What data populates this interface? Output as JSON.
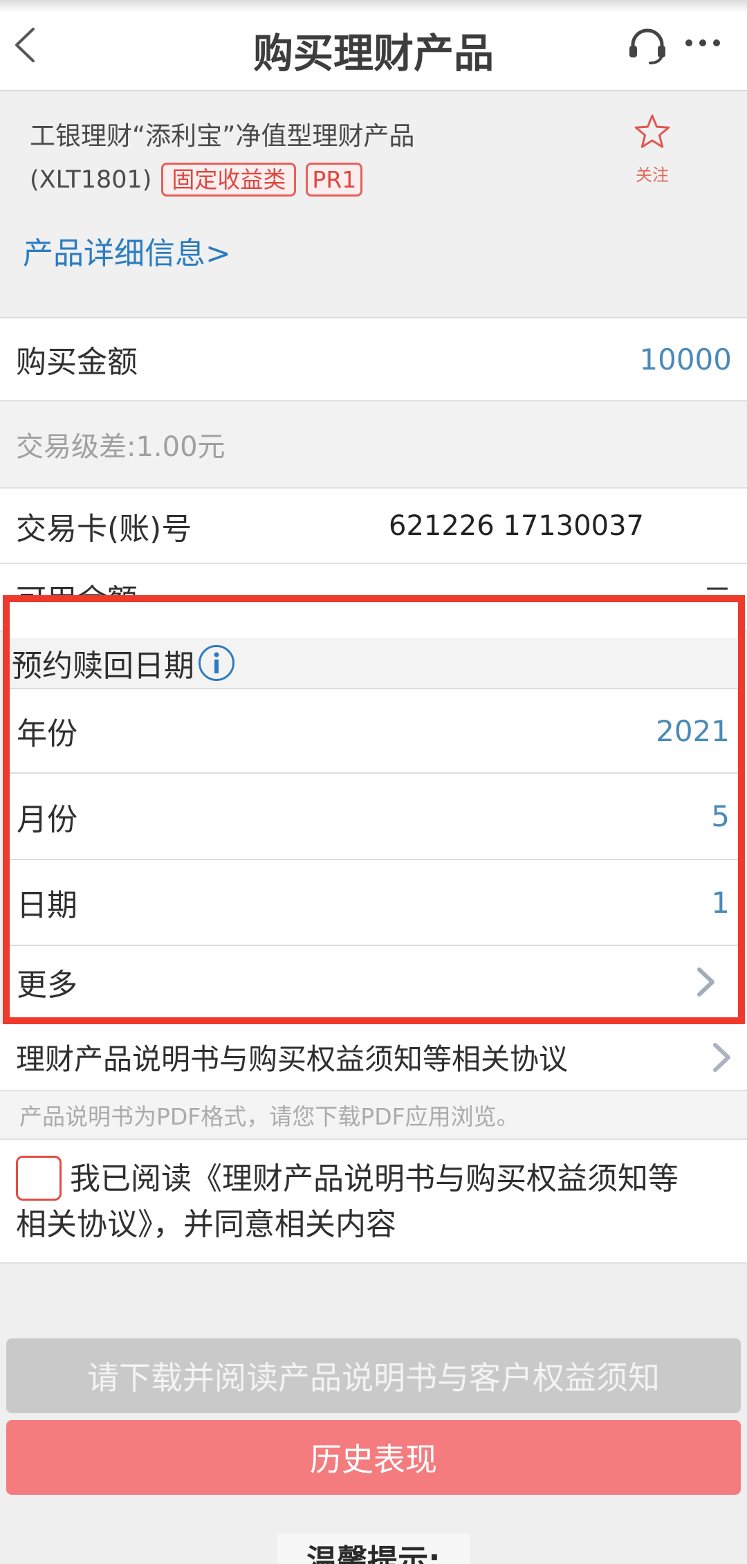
{
  "header": {
    "title": "购买理财产品",
    "back_icon": "chevron-left-icon",
    "service_icon": "headset-icon",
    "more_icon": "more-dots-icon"
  },
  "product": {
    "name": "工银理财“添利宝”净值型理财产品",
    "code": "(XLT1801)",
    "badges": [
      "固定收益类",
      "PR1"
    ],
    "follow_icon": "star-icon",
    "follow_label": "关注",
    "detail_link": "产品详细信息>"
  },
  "form": {
    "amount": {
      "label": "购买金额",
      "value": "10000"
    },
    "spread": "交易级差:1.00元",
    "card": {
      "label": "交易卡(账)号",
      "value": "621226 17130037"
    },
    "balance": {
      "label": "可用余额",
      "unit": "元"
    }
  },
  "redemption": {
    "title": "预约赎回日期",
    "info_icon": "info-icon",
    "rows": [
      {
        "label": "年份",
        "value": "2021"
      },
      {
        "label": "月份",
        "value": "5"
      },
      {
        "label": "日期",
        "value": "1"
      }
    ],
    "more_label": "更多",
    "more_icon": "chevron-right-icon"
  },
  "agreement": {
    "link_label": "理财产品说明书与购买权益须知等相关协议",
    "note": "产品说明书为PDF格式，请您下载PDF应用浏览。",
    "checkbox_line1": "我已阅读《理财产品说明书与购买权益须知等",
    "checkbox_line2": "相关协议》，并同意相关内容",
    "checked": false
  },
  "buttons": {
    "download_read": "请下载并阅读产品说明书与客户权益须知",
    "history": "历史表现"
  },
  "tip_title": "温馨提示:",
  "colors": {
    "value_blue": "#4a8ab8",
    "link_blue": "#2b7cc1",
    "highlight_red": "#ee3a2c",
    "badge_red": "#e0463f",
    "button_gray": "#c9c9c9",
    "button_pink": "#f47c7f"
  }
}
